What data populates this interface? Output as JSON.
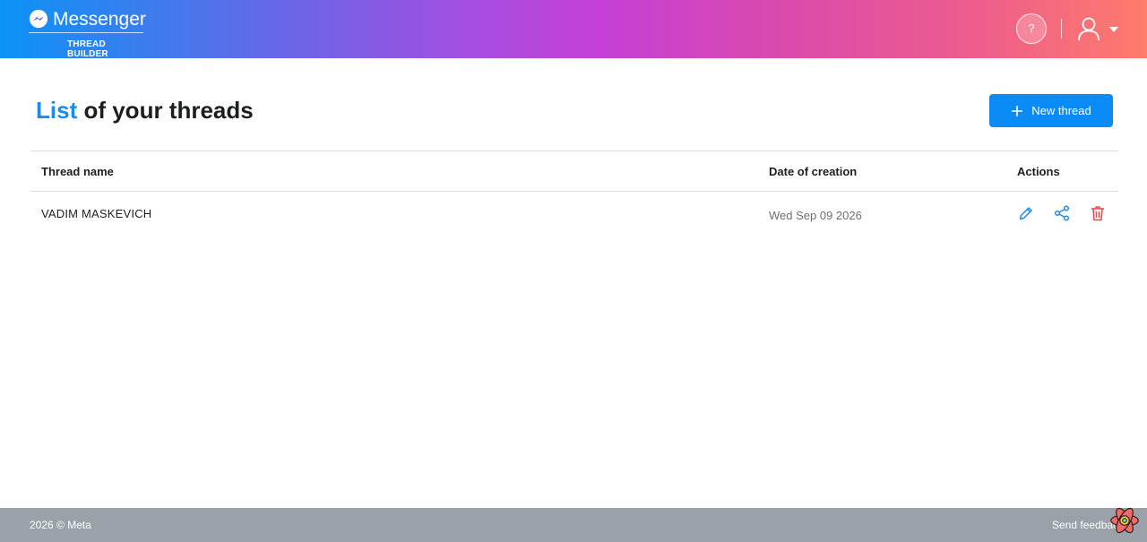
{
  "header": {
    "brand_name": "Messenger",
    "brand_subtitle": "THREAD BUILDER",
    "help_label": "?",
    "icons": {
      "logo": "messenger-logo-icon",
      "user": "user-icon",
      "caret": "chevron-down-icon"
    }
  },
  "page": {
    "title_accent": "List",
    "title_rest": " of your threads",
    "new_button_label": "New thread"
  },
  "table": {
    "columns": [
      "Thread name",
      "Date of creation",
      "Actions"
    ],
    "rows": [
      {
        "name": "VADIM MASKEVICH",
        "date": "Wed Sep 09 2026",
        "actions": [
          "pencil-icon",
          "share-icon",
          "trash-icon"
        ]
      }
    ]
  },
  "footer": {
    "copyright": "2026 © Meta",
    "feedback": "Send feedback"
  },
  "colors": {
    "accent": "#1a8cf0",
    "button": "#0a8bf5",
    "delete": "#e5484d",
    "footer": "#9aa1a8"
  }
}
